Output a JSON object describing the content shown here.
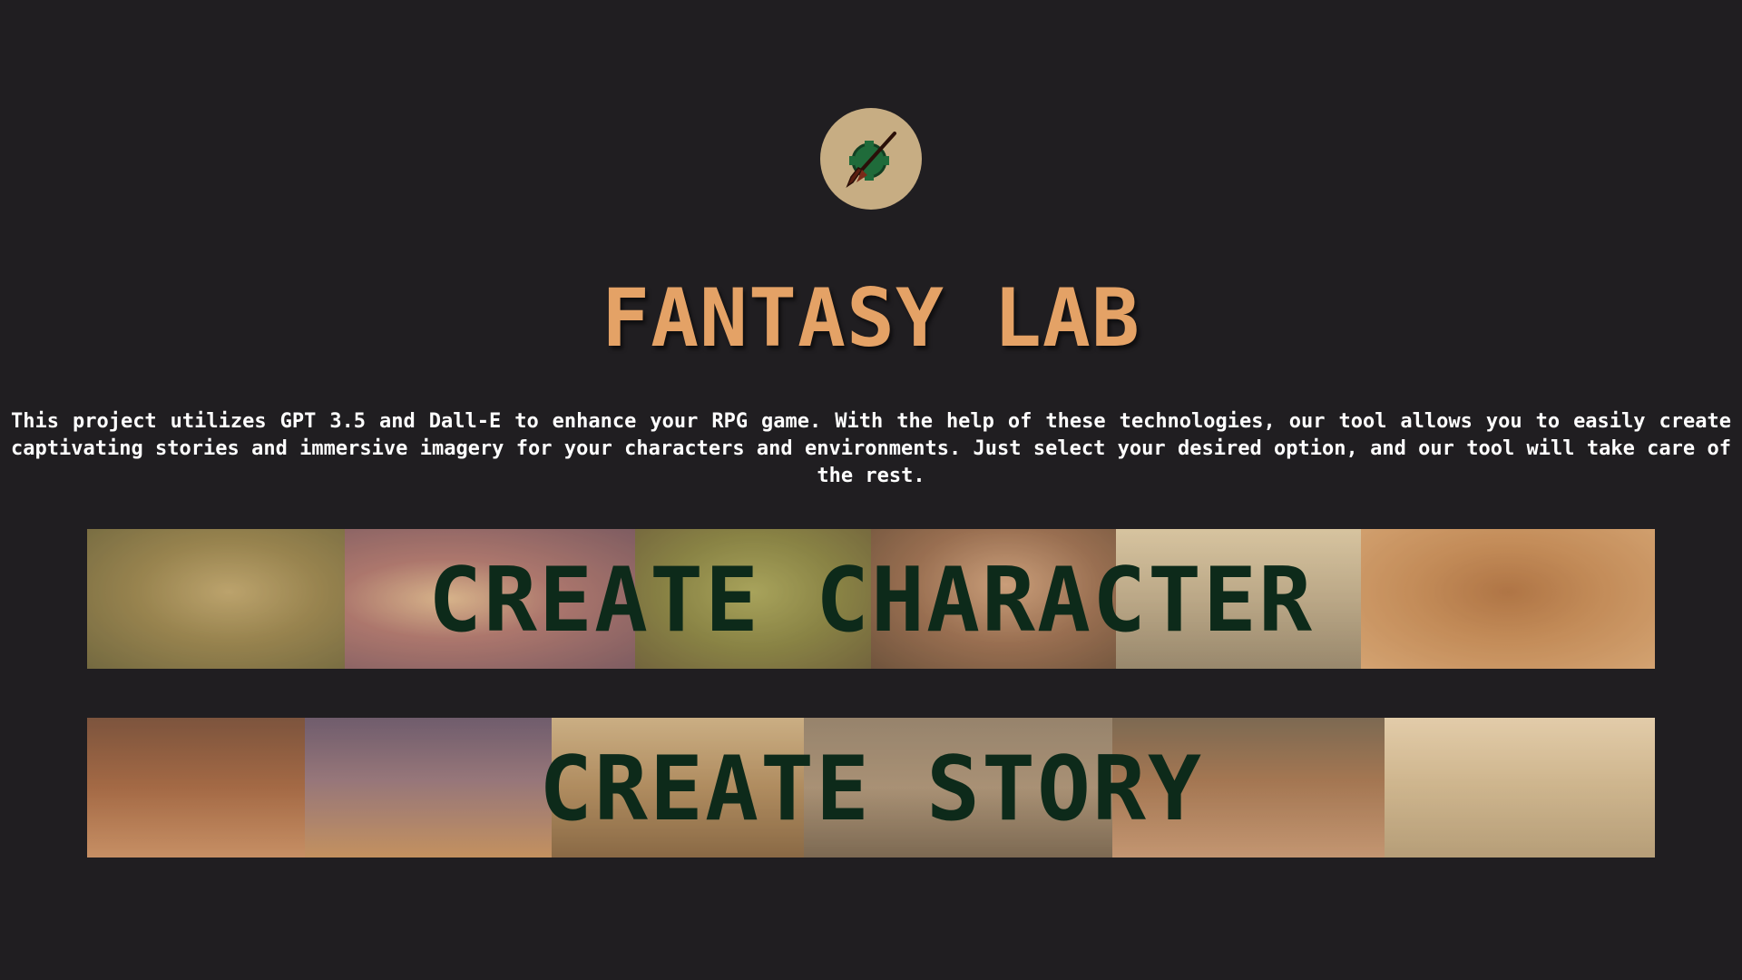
{
  "logo": {
    "icon": "compass-quill-icon",
    "colors": {
      "circle": "#c7ad83",
      "emblem": "#1f6b3a",
      "quill": "#5a1e10"
    }
  },
  "header": {
    "title": "FANTASY LAB"
  },
  "description": {
    "text": "This project utilizes GPT 3.5 and Dall-E to enhance your RPG game. With the help of these technologies, our tool allows you to easily create captivating stories and immersive imagery for your characters and environments. Just select your desired option, and our tool will take care of the rest."
  },
  "options": {
    "character": {
      "label": "CREATE CHARACTER"
    },
    "story": {
      "label": "CREATE STORY"
    }
  },
  "colors": {
    "background": "#201e21",
    "title": "#e4a266",
    "description": "#ffffff",
    "banner_text": "#0d2a1a"
  }
}
